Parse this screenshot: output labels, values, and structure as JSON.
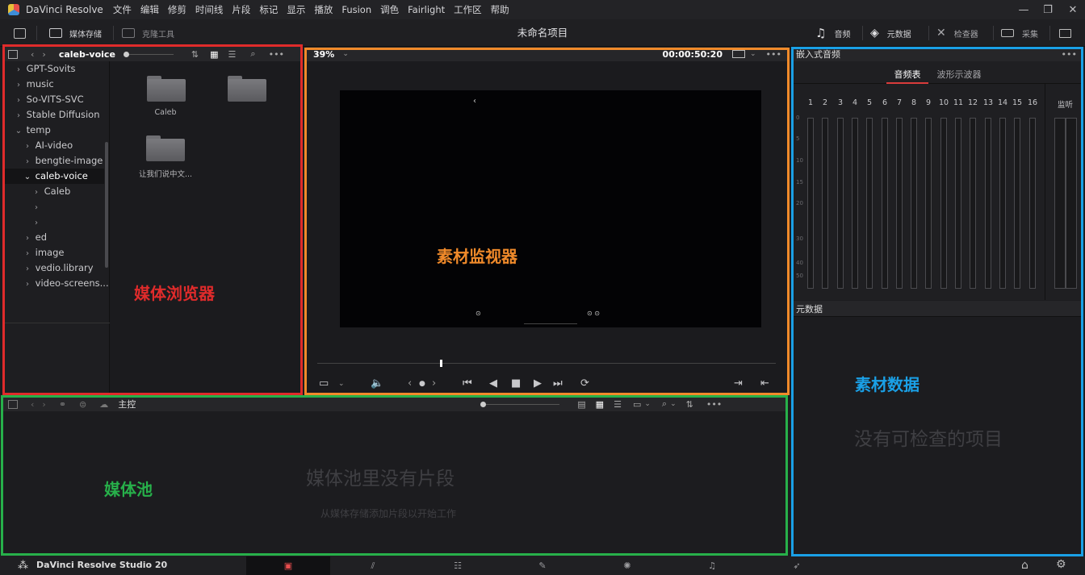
{
  "app": {
    "title": "DaVinci Resolve",
    "menu": [
      "文件",
      "编辑",
      "修剪",
      "时间线",
      "片段",
      "标记",
      "显示",
      "播放",
      "Fusion",
      "调色",
      "Fairlight",
      "工作区",
      "帮助"
    ],
    "window_controls": [
      "—",
      "❐",
      "✕"
    ]
  },
  "toolbar": {
    "media_storage": "媒体存储",
    "clone_tool": "克隆工具",
    "project_title": "未命名项目",
    "audio": "音频",
    "metadata": "元数据",
    "inspector": "检查器",
    "capture": "采集"
  },
  "browser": {
    "current_folder": "caleb-voice",
    "tree": [
      {
        "label": "GPT-Sovits",
        "chev": "›",
        "indent": 0
      },
      {
        "label": "music",
        "chev": "›",
        "indent": 0
      },
      {
        "label": "So-VITS-SVC",
        "chev": "›",
        "indent": 0
      },
      {
        "label": "Stable Diffusion",
        "chev": "›",
        "indent": 0
      },
      {
        "label": "temp",
        "chev": "⌄",
        "indent": 0
      },
      {
        "label": "AI-video",
        "chev": "›",
        "indent": 1
      },
      {
        "label": "bengtie-image",
        "chev": "›",
        "indent": 1
      },
      {
        "label": "caleb-voice",
        "chev": "⌄",
        "indent": 1,
        "selected": true
      },
      {
        "label": "Caleb",
        "chev": "›",
        "indent": 2
      },
      {
        "label": "",
        "chev": "›",
        "indent": 2
      },
      {
        "label": "",
        "chev": "›",
        "indent": 2
      },
      {
        "label": "ed",
        "chev": "›",
        "indent": 1
      },
      {
        "label": "image",
        "chev": "›",
        "indent": 1
      },
      {
        "label": "vedio.library",
        "chev": "›",
        "indent": 1
      },
      {
        "label": "video-screens...",
        "chev": "›",
        "indent": 1
      }
    ],
    "folders": [
      "Caleb",
      "",
      "让我们说中文..."
    ]
  },
  "viewer": {
    "zoom": "39%",
    "timecode": "00:00:50:20"
  },
  "audio_panel": {
    "title": "嵌入式音频",
    "tabs": [
      "音频表",
      "波形示波器"
    ],
    "active_tab": "音频表",
    "channels": [
      "1",
      "2",
      "3",
      "4",
      "5",
      "6",
      "7",
      "8",
      "9",
      "10",
      "11",
      "12",
      "13",
      "14",
      "15",
      "16"
    ],
    "monitor_label": "监听",
    "scale": [
      "0",
      "5",
      "10",
      "15",
      "20",
      "30",
      "40",
      "50"
    ]
  },
  "metadata_panel": {
    "title": "元数据",
    "empty_message": "没有可检查的项目"
  },
  "media_pool": {
    "title": "主控",
    "empty_title": "媒体池里没有片段",
    "empty_hint": "从媒体存储添加片段以开始工作"
  },
  "annotations": {
    "browser": "媒体浏览器",
    "viewer": "素材监视器",
    "metadata": "素材数据",
    "pool": "媒体池"
  },
  "annotation_colors": {
    "browser": "#e02b2b",
    "viewer": "#f08a2a",
    "metadata": "#1aa0e6",
    "pool": "#27b04a"
  },
  "footer": {
    "product": "DaVinci Resolve Studio 20"
  }
}
